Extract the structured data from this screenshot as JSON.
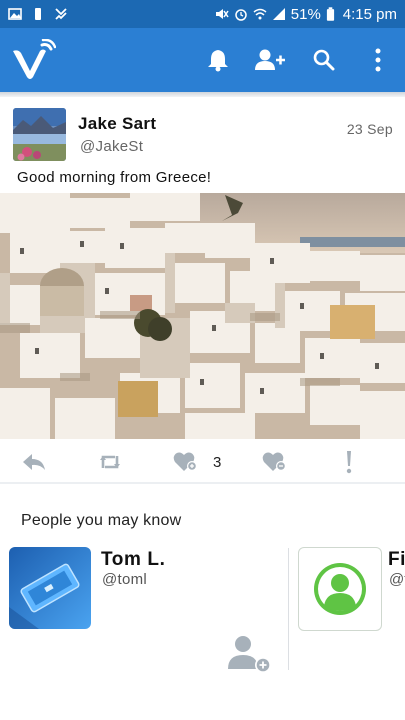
{
  "status_bar": {
    "battery": "51%",
    "time": "4:15 pm"
  },
  "app_bar": {
    "logo_letter": "V"
  },
  "tweet": {
    "author_name": "Jake Sart",
    "author_handle": "@JakeSt",
    "date": "23 Sep",
    "text": "Good morning from Greece!",
    "like_count": "3"
  },
  "people_you_may_know": {
    "title": "People you may know",
    "cards": [
      {
        "name": "Tom L.",
        "handle": "@toml"
      },
      {
        "name": "Fi",
        "handle": "@f"
      }
    ]
  },
  "colors": {
    "status_bar": "#1c69b3",
    "app_bar": "#2b7fd3",
    "icon_gray": "#a7b1ba",
    "default_avatar_green": "#5fc444"
  }
}
